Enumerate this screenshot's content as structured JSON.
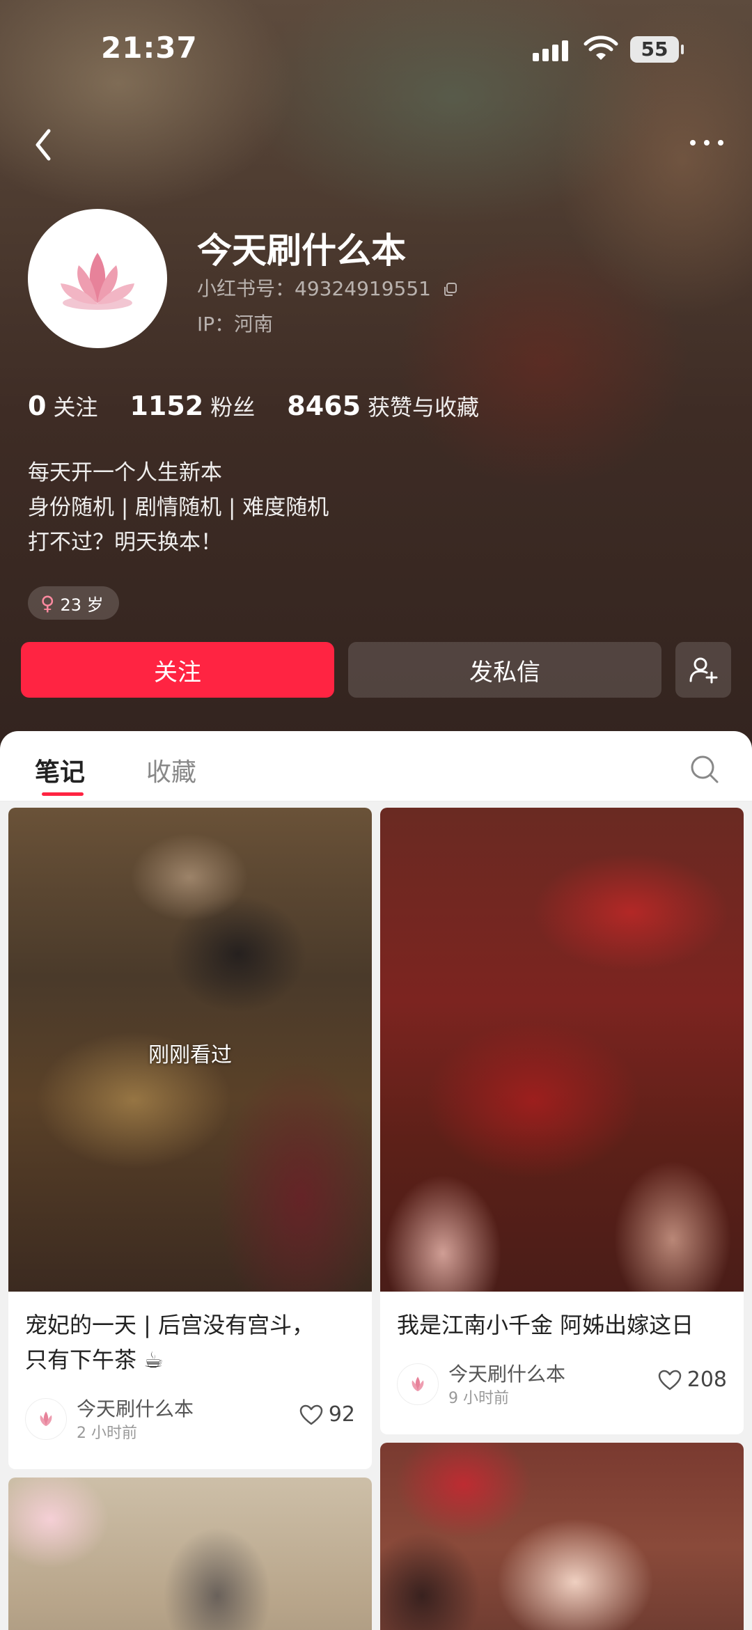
{
  "status_bar": {
    "time": "21:37",
    "battery": "55"
  },
  "profile": {
    "name": "今天刷什么本",
    "red_id": "小红书号：49324919551",
    "ip": "IP：河南",
    "stats": [
      {
        "value": "0",
        "label": "关注"
      },
      {
        "value": "1152",
        "label": "粉丝"
      },
      {
        "value": "8465",
        "label": "获赞与收藏"
      }
    ],
    "bio": [
      "每天开一个人生新本",
      "身份随机 | 剧情随机 | 难度随机",
      "打不过？明天换本！"
    ],
    "age": "23 岁"
  },
  "actions": {
    "follow": "关注",
    "message": "发私信"
  },
  "tabs": [
    {
      "label": "笔记"
    },
    {
      "label": "收藏"
    }
  ],
  "notes": [
    {
      "seen_label": "刚刚看过",
      "title_line1": "宠妃的一天 | 后宫没有宫斗，",
      "title_line2": "只有下午茶 ☕",
      "author": "今天刷什么本",
      "time": "2 小时前",
      "likes": "92"
    },
    {
      "title_line1": "我是江南小千金 阿姊出嫁这日",
      "author": "今天刷什么本",
      "time": "9 小时前",
      "likes": "208"
    }
  ],
  "colors": {
    "accent": "#ff2442",
    "lotus": "#e7829a"
  }
}
